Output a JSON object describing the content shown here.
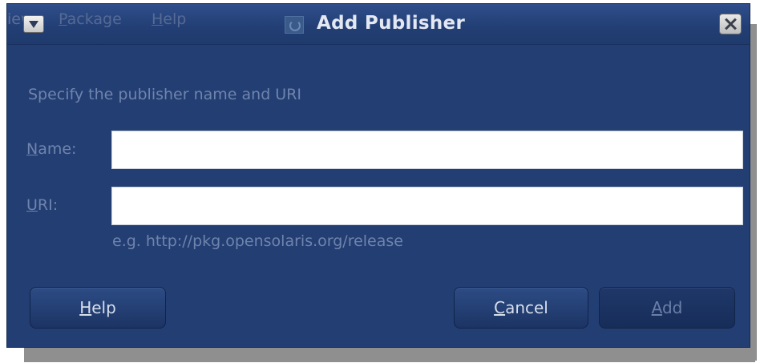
{
  "background_menu": {
    "partial_left": "iew",
    "package": {
      "mnemonic": "P",
      "rest": "ackage"
    },
    "help": {
      "mnemonic": "H",
      "rest": "elp"
    }
  },
  "dialog": {
    "title": "Add Publisher",
    "instructions": "Specify the publisher name and URI",
    "name_field": {
      "label_mnemonic": "N",
      "label_rest": "ame:",
      "value": ""
    },
    "uri_field": {
      "label_mnemonic": "U",
      "label_rest": "RI:",
      "value": ""
    },
    "uri_hint": "e.g. http://pkg.opensolaris.org/release",
    "buttons": {
      "help": {
        "mnemonic": "H",
        "rest": "elp"
      },
      "cancel": {
        "mnemonic": "C",
        "rest": "ancel"
      },
      "add": {
        "mnemonic": "A",
        "rest": "dd",
        "enabled": false
      }
    }
  },
  "colors": {
    "dialog_background": "#233e73",
    "label_text": "#6f84ad",
    "title_text": "#e3e8f2",
    "disabled_text": "#6a7ea8"
  },
  "icons": [
    "window-menu-icon",
    "package-manager-icon",
    "close-icon"
  ]
}
